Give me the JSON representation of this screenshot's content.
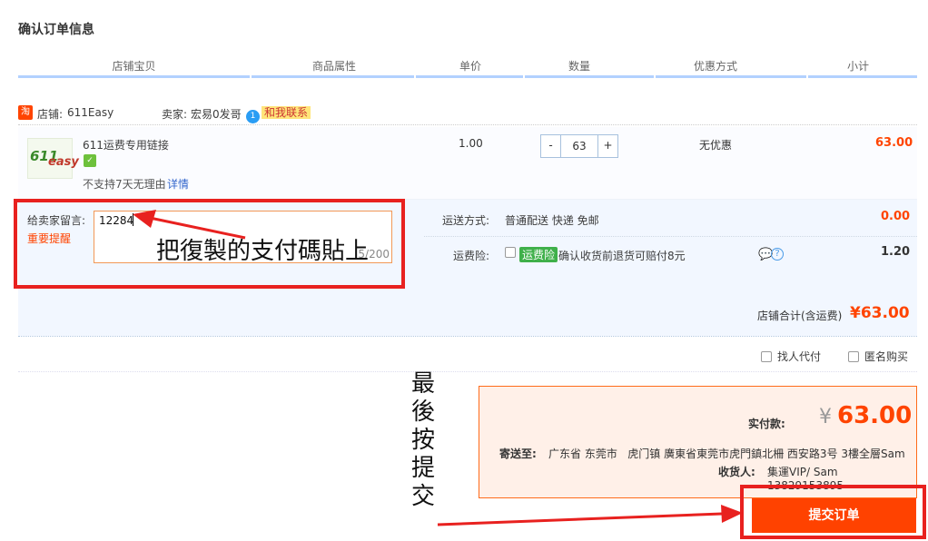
{
  "page_title": "确认订单信息",
  "columns": [
    "店铺宝贝",
    "商品属性",
    "单价",
    "数量",
    "优惠方式",
    "小计"
  ],
  "shop": {
    "icon_text": "淘",
    "shop_label": "店铺:",
    "shop_name": "611Easy",
    "seller_label": "卖家:",
    "seller_name": "宏易0发哥",
    "contact_label": "和我联系"
  },
  "item": {
    "image_text_1": "611",
    "image_text_2": "easy",
    "name": "611运费专用链接",
    "price": "1.00",
    "quantity": "63",
    "minus": "-",
    "plus": "+",
    "discount": "无优惠",
    "subtotal": "63.00",
    "return_policy": "不支持7天无理由",
    "detail_link": "详情"
  },
  "message": {
    "label": "给卖家留言:",
    "reminder": "重要提醒",
    "value": "12284",
    "counter": "5/200"
  },
  "shipping": {
    "label": "运送方式:",
    "method": "普通配送 快递 免邮",
    "cost": "0.00"
  },
  "insurance": {
    "label": "运费险:",
    "tag": "运费险",
    "desc": "确认收货前退货可赔付8元",
    "cost": "1.20"
  },
  "shop_total": {
    "label": "店铺合计(含运费)",
    "value": "¥63.00"
  },
  "options": {
    "proxy_pay": "找人代付",
    "anonymous": "匿名购买"
  },
  "payment": {
    "actual_label": "实付款:",
    "currency": "¥",
    "amount": "63.00",
    "ship_to_label": "寄送至:",
    "address": "广东省 东莞市   虎门镇 廣東省東莞市虎門鎮北柵 西安路3号 3樓全層Sam",
    "receiver_label": "收货人:",
    "receiver": "集運VIP/ Sam 13829153895"
  },
  "submit_label": "提交订单",
  "annotations": {
    "paste_hint": "把復製的支付碼貼上",
    "final_submit": [
      "最",
      "後",
      "按",
      "提",
      "交"
    ]
  },
  "colors": {
    "accent": "#ff4200",
    "annotation_red": "#e8211f",
    "header_line": "#b2d1ff"
  }
}
